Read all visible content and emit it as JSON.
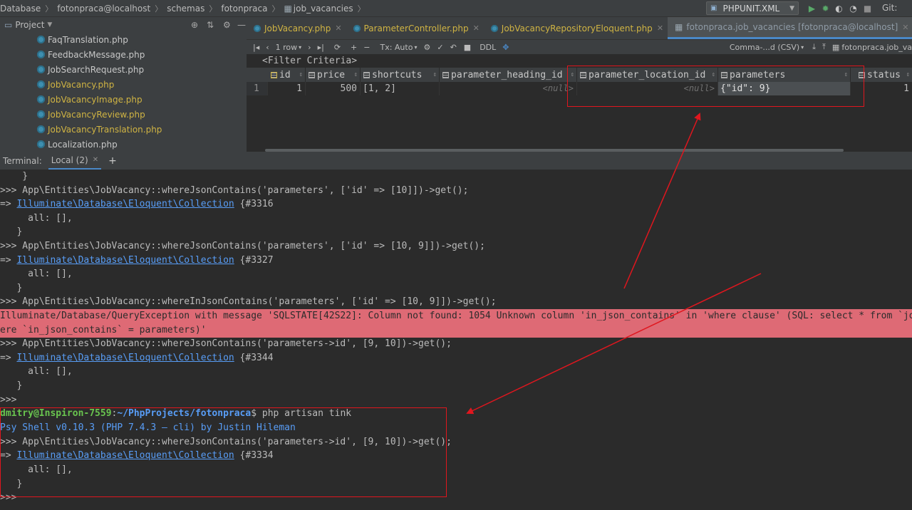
{
  "navbar": {
    "crumbs": [
      "Database",
      "fotonpraca@localhost",
      "schemas",
      "fotonpraca",
      "job_vacancies"
    ],
    "run_config": "PHPUNIT.XML",
    "git_label": "Git:"
  },
  "project_panel": {
    "title": "Project",
    "files": [
      {
        "name": "FaqTranslation.php",
        "style": "plain"
      },
      {
        "name": "FeedbackMessage.php",
        "style": "plain"
      },
      {
        "name": "JobSearchRequest.php",
        "style": "plain"
      },
      {
        "name": "JobVacancy.php",
        "style": "yellow"
      },
      {
        "name": "JobVacancyImage.php",
        "style": "yellow"
      },
      {
        "name": "JobVacancyReview.php",
        "style": "yellow"
      },
      {
        "name": "JobVacancyTranslation.php",
        "style": "yellow"
      },
      {
        "name": "Localization.php",
        "style": "plain"
      }
    ]
  },
  "editor_tabs": [
    {
      "label": "JobVacancy.php"
    },
    {
      "label": "ParameterController.php"
    },
    {
      "label": "JobVacancyRepositoryEloquent.php"
    },
    {
      "label": "fotonpraca.job_vacancies [fotonpraca@localhost]"
    }
  ],
  "grid_toolbar": {
    "rows": "1 row",
    "tx": "Tx: Auto",
    "ddl": "DDL",
    "export": "Comma-...d (CSV)",
    "target": "fotonpraca.job_va"
  },
  "grid": {
    "filter": "<Filter Criteria>",
    "columns": [
      "id",
      "price",
      "shortcuts",
      "parameter_heading_id",
      "parameter_location_id",
      "parameters",
      "status"
    ],
    "row_number": "1",
    "row": {
      "id": "1",
      "price": "500",
      "shortcuts": "[1, 2]",
      "parameter_heading_id": "<null>",
      "parameter_location_id": "<null>",
      "parameters": "{\"id\": 9}",
      "status": "1"
    }
  },
  "terminal": {
    "tab_title": "Terminal:",
    "tab_local": "Local (2)",
    "lines": [
      {
        "type": "plain",
        "text": "    }"
      },
      {
        "type": "plain",
        "text": ">>> App\\Entities\\JobVacancy::whereJsonContains('parameters', ['id' => [10]])->get();"
      },
      {
        "type": "result",
        "prefix": "=> ",
        "link": "Illuminate\\Database\\Eloquent\\Collection",
        "suffix": " {#3316"
      },
      {
        "type": "plain",
        "text": "     all: [],"
      },
      {
        "type": "plain",
        "text": "   }"
      },
      {
        "type": "plain",
        "text": ">>> App\\Entities\\JobVacancy::whereJsonContains('parameters', ['id' => [10, 9]])->get();"
      },
      {
        "type": "result",
        "prefix": "=> ",
        "link": "Illuminate\\Database\\Eloquent\\Collection",
        "suffix": " {#3327"
      },
      {
        "type": "plain",
        "text": "     all: [],"
      },
      {
        "type": "plain",
        "text": "   }"
      },
      {
        "type": "plain",
        "text": ">>> App\\Entities\\JobVacancy::whereInJsonContains('parameters', ['id' => [10, 9]])->get();"
      },
      {
        "type": "error",
        "text": "Illuminate/Database/QueryException with message 'SQLSTATE[42S22]: Column not found: 1054 Unknown column 'in_json_contains' in 'where clause' (SQL: select * from `job_vac"
      },
      {
        "type": "error",
        "text": "ere `in_json_contains` = parameters)'"
      },
      {
        "type": "plain",
        "text": ">>> App\\Entities\\JobVacancy::whereJsonContains('parameters->id', [9, 10])->get();"
      },
      {
        "type": "result",
        "prefix": "=> ",
        "link": "Illuminate\\Database\\Eloquent\\Collection",
        "suffix": " {#3344"
      },
      {
        "type": "plain",
        "text": "     all: [],"
      },
      {
        "type": "plain",
        "text": "   }"
      },
      {
        "type": "plain",
        "text": ">>>"
      },
      {
        "type": "prompt",
        "user": "dmitry@Inspiron-7559",
        "sep": ":",
        "path": "~/PhpProjects/fotonpraca",
        "cmd": "$ php artisan tink"
      },
      {
        "type": "psy",
        "text": "Psy Shell v0.10.3 (PHP 7.4.3 — cli) by Justin Hileman"
      },
      {
        "type": "plain",
        "text": ">>> App\\Entities\\JobVacancy::whereJsonContains('parameters->id', [9, 10])->get();"
      },
      {
        "type": "result",
        "prefix": "=> ",
        "link": "Illuminate\\Database\\Eloquent\\Collection",
        "suffix": " {#3334"
      },
      {
        "type": "plain",
        "text": "     all: [],"
      },
      {
        "type": "plain",
        "text": "   }"
      },
      {
        "type": "plain",
        "text": ">>>"
      }
    ]
  }
}
